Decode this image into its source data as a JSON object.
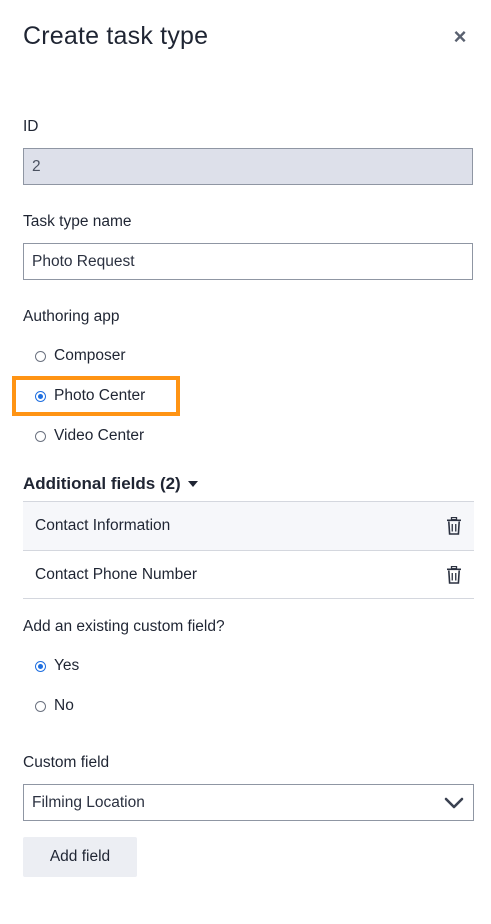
{
  "panel": {
    "title": "Create task type",
    "close_glyph": "×"
  },
  "id_field": {
    "label": "ID",
    "value": "2"
  },
  "name_field": {
    "label": "Task type name",
    "value": "Photo Request"
  },
  "authoring_app": {
    "label": "Authoring app",
    "options": [
      {
        "label": "Composer",
        "checked": false
      },
      {
        "label": "Photo Center",
        "checked": true
      },
      {
        "label": "Video Center",
        "checked": false
      }
    ]
  },
  "additional_fields": {
    "title": "Additional fields (2)",
    "items": [
      {
        "label": "Contact Information",
        "icon": "trash-icon"
      },
      {
        "label": "Contact Phone Number",
        "icon": "trash-icon"
      }
    ]
  },
  "existing_custom_field": {
    "label": "Add an existing custom field?",
    "options": [
      {
        "label": "Yes",
        "checked": true
      },
      {
        "label": "No",
        "checked": false
      }
    ]
  },
  "custom_field": {
    "label": "Custom field",
    "selected": "Filming Location"
  },
  "add_button": {
    "label": "Add field"
  },
  "colors": {
    "accent": "#1f6fe0",
    "highlight": "#ff9414",
    "readonly_bg": "#dde0ea"
  }
}
